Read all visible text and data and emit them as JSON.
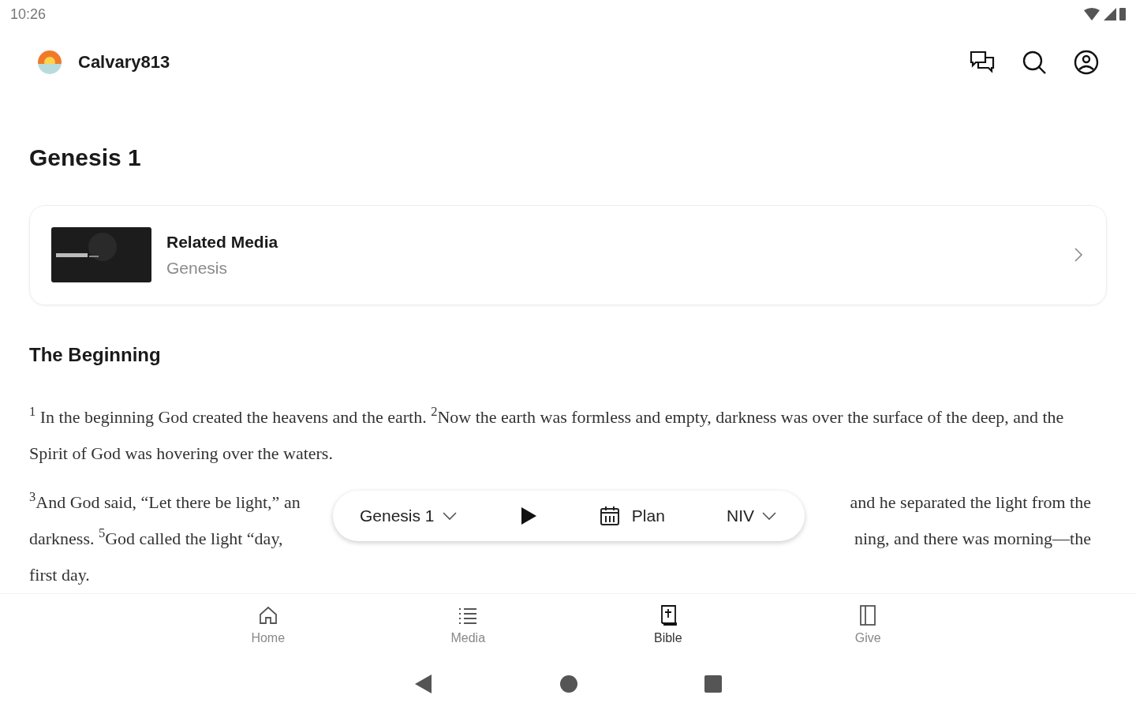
{
  "status_bar": {
    "time": "10:26"
  },
  "header": {
    "app_name": "Calvary813"
  },
  "page_title": "Genesis 1",
  "related_media": {
    "title": "Related Media",
    "subtitle": "Genesis"
  },
  "section_heading": "The Beginning",
  "paragraph_1": "$^{1}$ In the beginning God created the heavens and the earth. $^{2}$Now the earth was formless and empty, darkness was over the surface of the deep, and the Spirit of God was hovering over the waters.",
  "paragraph_2_lines": [
    {
      "left": "$^{3}$And God said, “Let there be light,” an",
      "right": "and he separated the light from the"
    },
    {
      "left": "darkness. $^{5}$God called the light “day,",
      "right": "ning, and there was morning—the"
    },
    {
      "left": "first day."
    }
  ],
  "reader_toolbar": {
    "chapter": "Genesis 1",
    "plan": "Plan",
    "version": "NIV"
  },
  "bottom_nav": [
    {
      "label": "Home",
      "kind": "home",
      "selected": false
    },
    {
      "label": "Media",
      "kind": "media",
      "selected": false
    },
    {
      "label": "Bible",
      "kind": "bible",
      "selected": true
    },
    {
      "label": "Give",
      "kind": "give",
      "selected": false
    }
  ]
}
